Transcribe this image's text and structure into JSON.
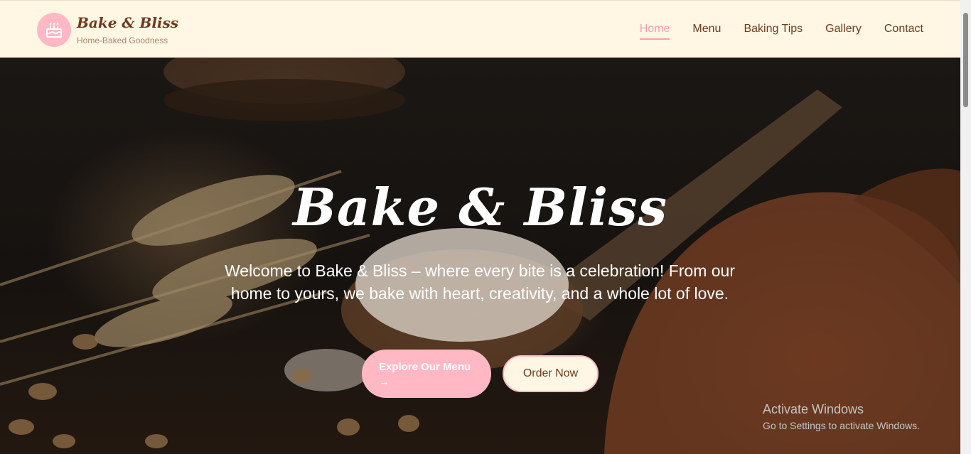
{
  "brand": {
    "name": "Bake & Bliss",
    "tagline": "Home-Baked Goodness",
    "logo_icon": "cake-icon",
    "accent_color": "#ffb8c4"
  },
  "nav": {
    "items": [
      {
        "label": "Home",
        "active": true
      },
      {
        "label": "Menu",
        "active": false
      },
      {
        "label": "Baking Tips",
        "active": false
      },
      {
        "label": "Gallery",
        "active": false
      },
      {
        "label": "Contact",
        "active": false
      }
    ]
  },
  "hero": {
    "title": "Bake & Bliss",
    "text": "Welcome to Bake & Bliss – where every bite is a celebration! From our home to yours, we bake with heart, creativity, and a whole lot of love.",
    "primary_button": "Explore Our Menu",
    "primary_button_icon": "arrow-right-icon",
    "secondary_button": "Order Now"
  },
  "watermark": {
    "line1": "Activate Windows",
    "line2": "Go to Settings to activate Windows."
  }
}
